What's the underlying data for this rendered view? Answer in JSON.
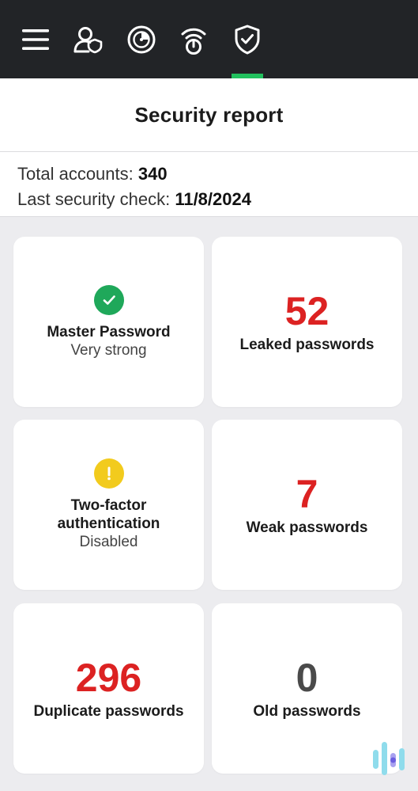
{
  "nav": {
    "items": [
      {
        "name": "menu",
        "icon": "hamburger-menu-icon"
      },
      {
        "name": "identity",
        "icon": "person-shield-icon"
      },
      {
        "name": "vault",
        "icon": "safe-dial-icon"
      },
      {
        "name": "connection",
        "icon": "signal-power-icon"
      },
      {
        "name": "security",
        "icon": "shield-check-icon",
        "active": true
      }
    ],
    "active_color": "#22c15e"
  },
  "header": {
    "title": "Security report"
  },
  "summary": {
    "total_accounts_label": "Total accounts:",
    "total_accounts_value": "340",
    "last_check_label": "Last security check:",
    "last_check_value": "11/8/2024"
  },
  "cards": {
    "master_password": {
      "title": "Master Password",
      "status": "Very strong",
      "icon": "check-circle-icon",
      "color": "#1fa85a"
    },
    "leaked": {
      "value": "52",
      "label": "Leaked passwords",
      "color": "#dc2222"
    },
    "two_factor": {
      "title_line1": "Two-factor",
      "title_line2": "authentication",
      "status": "Disabled",
      "icon": "warning-circle-icon",
      "color": "#f2cb1d"
    },
    "weak": {
      "value": "7",
      "label": "Weak passwords",
      "color": "#dc2222"
    },
    "duplicate": {
      "value": "296",
      "label": "Duplicate passwords",
      "color": "#dc2222"
    },
    "old": {
      "value": "0",
      "label": "Old passwords",
      "color": "#4a4a4a"
    }
  }
}
